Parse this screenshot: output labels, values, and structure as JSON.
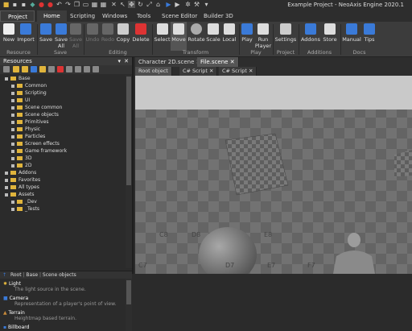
{
  "window": {
    "title": "Example Project - NeoAxis Engine 2020.1"
  },
  "project_tab": "Project",
  "ribbon_tabs": [
    "Home",
    "Scripting",
    "Windows",
    "Tools",
    "Scene Editor",
    "Builder 3D"
  ],
  "ribbon": {
    "buttons": [
      "New",
      "Import",
      "Save",
      "Save All",
      "Save All",
      "Undo",
      "Redo",
      "Copy",
      "Delete",
      "Select",
      "Move",
      "Rotate",
      "Scale",
      "Local",
      "Play",
      "Run Player",
      "Settings",
      "Addons",
      "Store",
      "Manual",
      "Tips"
    ],
    "groups": [
      "Resource",
      "Save",
      "Editing",
      "Transform",
      "Play",
      "Project",
      "Additions",
      "Docs"
    ]
  },
  "resources": {
    "title": "Resources",
    "tree": [
      "Base",
      "Common",
      "Scripting",
      "UI",
      "Scene common",
      "Scene objects",
      "Primitives",
      "Physic",
      "Particles",
      "Screen effects",
      "Game framework",
      "3D",
      "2D",
      "Addons",
      "Favorites",
      "All types",
      "Assets",
      "_Dev",
      "_Tests"
    ],
    "breadcrumb": [
      "Root",
      "Base",
      "Scene objects"
    ],
    "objects": [
      {
        "name": "Light",
        "desc": "The light source in the scene."
      },
      {
        "name": "Camera",
        "desc": "Representation of a player's point of view."
      },
      {
        "name": "Terrain",
        "desc": "Heightmap based terrain."
      },
      {
        "name": "Billboard",
        "desc": ""
      }
    ]
  },
  "doc_tabs": [
    "Character 2D.scene",
    "File.scene"
  ],
  "sub_tabs": [
    "Root object",
    "C# Script",
    "C# Script"
  ],
  "viewport": {
    "sky_color": "#c9c9c9",
    "floor_color": "#6e6e6e",
    "labels": [
      "C8",
      "D8",
      "E8",
      "C7",
      "D7",
      "E7",
      "F7"
    ]
  },
  "colors": {
    "accent": "#3a7ad8",
    "folder": "#e0b43c"
  }
}
